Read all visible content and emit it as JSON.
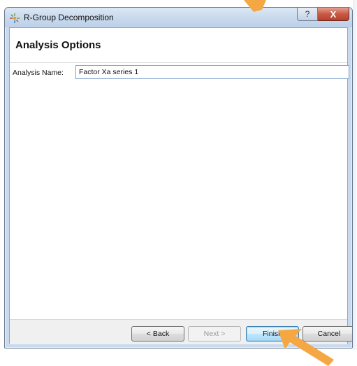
{
  "window": {
    "title": "R-Group Decomposition",
    "help_glyph": "?",
    "close_glyph": "X"
  },
  "page": {
    "title": "Analysis Options"
  },
  "form": {
    "analysis_name_label": "Analysis Name:",
    "analysis_name_value": "Factor Xa series 1"
  },
  "buttons": {
    "back_label": "< Back",
    "next_label": "Next >",
    "finish_label": "Finish",
    "cancel_label": "Cancel"
  },
  "colors": {
    "annotation_arrow": "#f4a742",
    "default_button_border": "#3c7fb1",
    "close_button": "#c75a46"
  },
  "icons": {
    "app_icon": "r-group-app-icon",
    "pointer": "orange-arrow"
  }
}
